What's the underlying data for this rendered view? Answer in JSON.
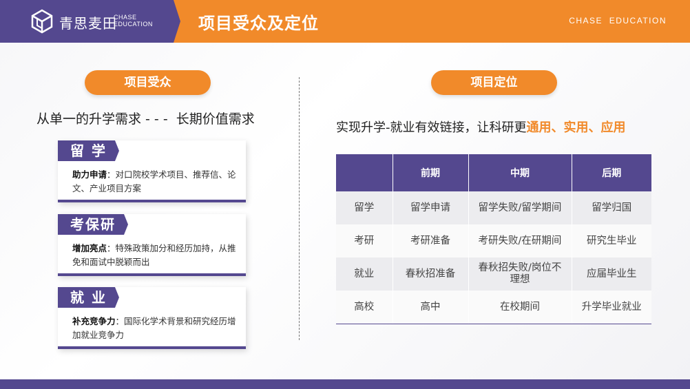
{
  "header": {
    "logo_cn": "青思麦田",
    "logo_en_line1": "CHASE",
    "logo_en_line2": "EDUCATION",
    "title": "项目受众及定位",
    "brand_en": "CHASE  EDUCATION",
    "colors": {
      "orange": "#f18a2a",
      "purple": "#54488f"
    }
  },
  "left": {
    "pill": "项目受众",
    "subtitle": "从单一的升学需求 - - -  长期价值需求",
    "cards": [
      {
        "label": "留 学",
        "bold": "助力申请",
        "text": "：对口院校学术项目、推荐信、论文、产业项目方案"
      },
      {
        "label": "考保研",
        "bold": "增加亮点",
        "text": "：特殊政策加分和经历加持，从推免和面试中脱颖而出"
      },
      {
        "label": "就 业",
        "bold": "补充竞争力",
        "text": "：国际化学术背景和研究经历增加就业竞争力"
      }
    ]
  },
  "right": {
    "pill": "项目定位",
    "subtitle_prefix": "实现升学-就业有效链接，让科研更",
    "subtitle_highlight": "通用、实用、应用",
    "table": {
      "headers": [
        "",
        "前期",
        "中期",
        "后期"
      ],
      "rows": [
        [
          "留学",
          "留学申请",
          "留学失败/留学期间",
          "留学归国"
        ],
        [
          "考研",
          "考研准备",
          "考研失败/在研期间",
          "研究生毕业"
        ],
        [
          "就业",
          "春秋招准备",
          "春秋招失败/岗位不理想",
          "应届毕业生"
        ],
        [
          "高校",
          "高中",
          "在校期间",
          "升学毕业就业"
        ]
      ]
    }
  }
}
